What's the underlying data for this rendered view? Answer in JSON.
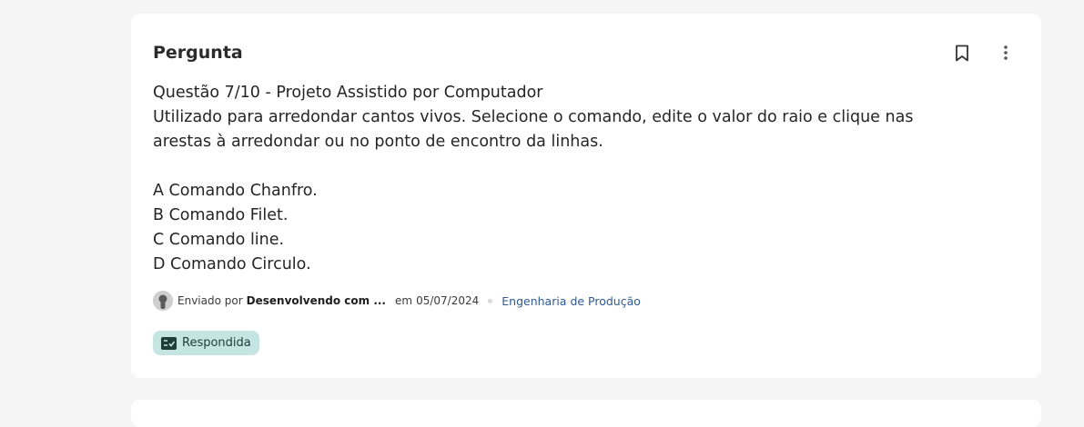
{
  "question_card": {
    "title": "Pergunta",
    "question_lines": [
      "Questão 7/10 - Projeto Assistido por Computador",
      "Utilizado para arredondar cantos vivos. Selecione o comando, edite o valor do raio e clique nas",
      "arestas à arredondar ou no ponto de encontro da linhas."
    ],
    "options": [
      "A Comando Chanfro.",
      "B Comando Filet.",
      "C Comando line.",
      "D Comando Circulo."
    ],
    "meta": {
      "sent_by_label": "Enviado por",
      "author": "Desenvolvendo com ...",
      "date_prefix": "em",
      "date": "05/07/2024",
      "topic": "Engenharia de Produção"
    },
    "status_badge": "Respondida",
    "icons": {
      "bookmark": "bookmark-icon",
      "more": "more-vertical-icon",
      "avatar": "user-avatar-icon",
      "badge": "checklist-icon"
    },
    "colors": {
      "badge_bg": "#c5e5e2",
      "link": "#2f5a94"
    }
  }
}
